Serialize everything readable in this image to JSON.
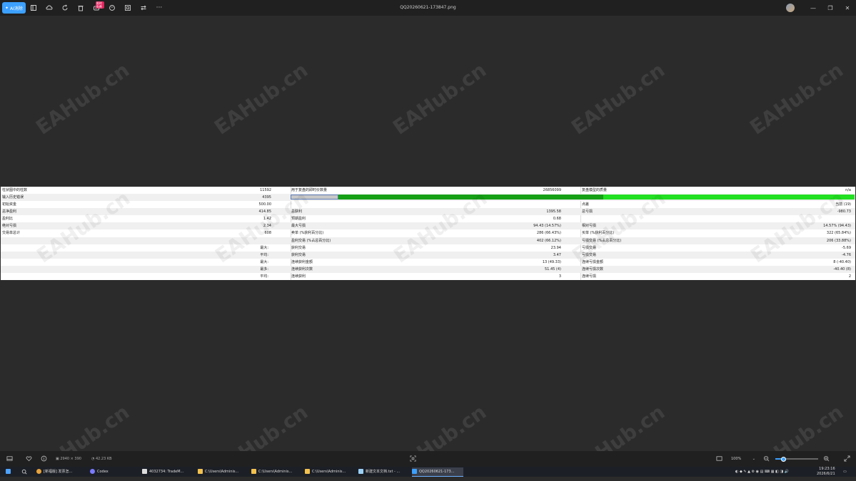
{
  "toolbar": {
    "ai_button_label": "AI消除",
    "badge": "限时免费",
    "more": "···"
  },
  "window": {
    "title": "QQ20260621-173847.png"
  },
  "watermark": "EAHub.cn",
  "report": {
    "col1": [
      {
        "label": "柱状图中的柱数",
        "value": "11592"
      },
      {
        "label": "输入历史错误",
        "value": "4395"
      },
      {
        "label": "初始资金",
        "value": "500.00"
      },
      {
        "label": "总净盈利",
        "value": "414.85"
      },
      {
        "label": "盈利比",
        "value": "1.42"
      },
      {
        "label": "绝对亏损",
        "value": "2.34"
      },
      {
        "label": "交易单总计",
        "value": "608"
      },
      {
        "label": "",
        "value": ""
      },
      {
        "label": "",
        "value": "",
        "sub": "最大:"
      },
      {
        "label": "",
        "value": "",
        "sub": "平均:"
      },
      {
        "label": "",
        "value": "",
        "sub": "最大:"
      },
      {
        "label": "",
        "value": "",
        "sub": "最多:"
      },
      {
        "label": "",
        "value": "",
        "sub": "平均:"
      }
    ],
    "col2": [
      {
        "label": "用于复盘的即时价数量",
        "value": "26856099"
      },
      {
        "label": "",
        "value": ""
      },
      {
        "label": "",
        "value": ""
      },
      {
        "label": "总获利",
        "value": "1395.58"
      },
      {
        "label": "预期盈利",
        "value": "0.68"
      },
      {
        "label": "最大亏损",
        "value": "94.43 (14.57%)"
      },
      {
        "label": "卖单 (%获利百分比)",
        "value": "286 (66.43%)"
      },
      {
        "label": "盈利交易 (%占总百分比)",
        "value": "402 (66.12%)"
      },
      {
        "label": "获利交易",
        "value": "23.94"
      },
      {
        "label": "获利交易",
        "value": "3.47"
      },
      {
        "label": "连续获利金额",
        "value": "13 (49.33)"
      },
      {
        "label": "连续获利次数",
        "value": "51.45 (4)"
      },
      {
        "label": "连续获利",
        "value": "3"
      }
    ],
    "col3": [
      {
        "label": "复盘模型的质量",
        "value": "n/a"
      },
      {
        "label": "",
        "value": ""
      },
      {
        "label": "点差",
        "value": "当前 (19)"
      },
      {
        "label": "总亏损",
        "value": "-980.73"
      },
      {
        "label": "",
        "value": ""
      },
      {
        "label": "相对亏损",
        "value": "14.57% (94.43)"
      },
      {
        "label": "买单 (%获利百分比)",
        "value": "322 (65.84%)"
      },
      {
        "label": "亏损交易 (%占总百分比)",
        "value": "206 (33.88%)"
      },
      {
        "label": "亏损交易",
        "value": "-5.69"
      },
      {
        "label": "亏损交易",
        "value": "-4.76"
      },
      {
        "label": "连续亏损金额",
        "value": "8 (-40.40)"
      },
      {
        "label": "连续亏损次数",
        "value": "-40.40 (8)"
      },
      {
        "label": "连续亏损",
        "value": "2"
      }
    ],
    "quality_bar": {
      "gray_fraction": 0.085,
      "dark_green_fraction": 0.47,
      "light_green_fraction": 0.445
    },
    "colors": {
      "gray": "#c8c8c8",
      "dark_green": "#16a016",
      "light_green": "#22e022"
    }
  },
  "statusbar": {
    "dimensions": "2940 × 390",
    "size": "42.23 KB",
    "zoom": "100%"
  },
  "taskbar": {
    "items": [
      {
        "label": "[新福版] 发票怎..."
      },
      {
        "label": "Codex"
      },
      {
        "label": "4032734: TradeM..."
      },
      {
        "label": "C:\\Users\\Adminis..."
      },
      {
        "label": "C:\\Users\\Adminis..."
      },
      {
        "label": "C:\\Users\\Adminis..."
      },
      {
        "label": "新建文本文档.txt - ..."
      },
      {
        "label": "QQ20260621-173..."
      }
    ],
    "time": "19:23:16",
    "date": "2026/6/21"
  }
}
